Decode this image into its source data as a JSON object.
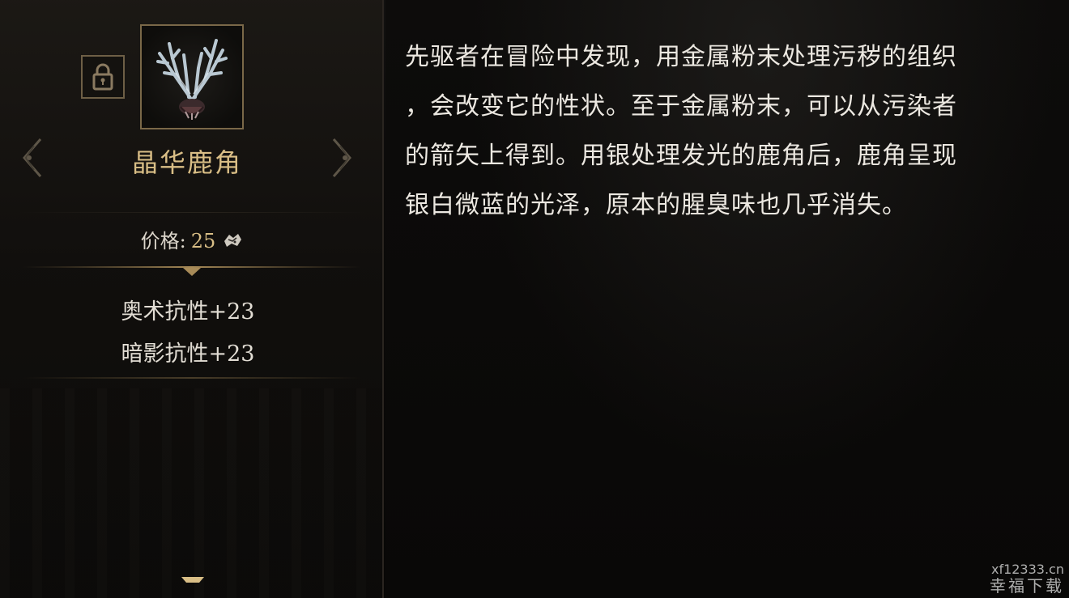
{
  "item": {
    "name": "晶华鹿角",
    "icon": "crystal-antler-icon",
    "locked_icon": "lock-icon"
  },
  "price": {
    "label": "价格:",
    "value": "25",
    "currency_icon": "coin-icon"
  },
  "stats": [
    "奥术抗性+23",
    "暗影抗性+23"
  ],
  "description": "先驱者在冒险中发现，用金属粉末处理污秽的组织\n，会改变它的性状。至于金属粉末，可以从污染者\n的箭矢上得到。用银处理发光的鹿角后，鹿角呈现\n银白微蓝的光泽，原本的腥臭味也几乎消失。",
  "watermark": {
    "url": "xf12333.cn",
    "name": "幸福下载"
  },
  "colors": {
    "gold": "#d9be86",
    "frame": "#7a6848",
    "text": "#ece8e1"
  }
}
